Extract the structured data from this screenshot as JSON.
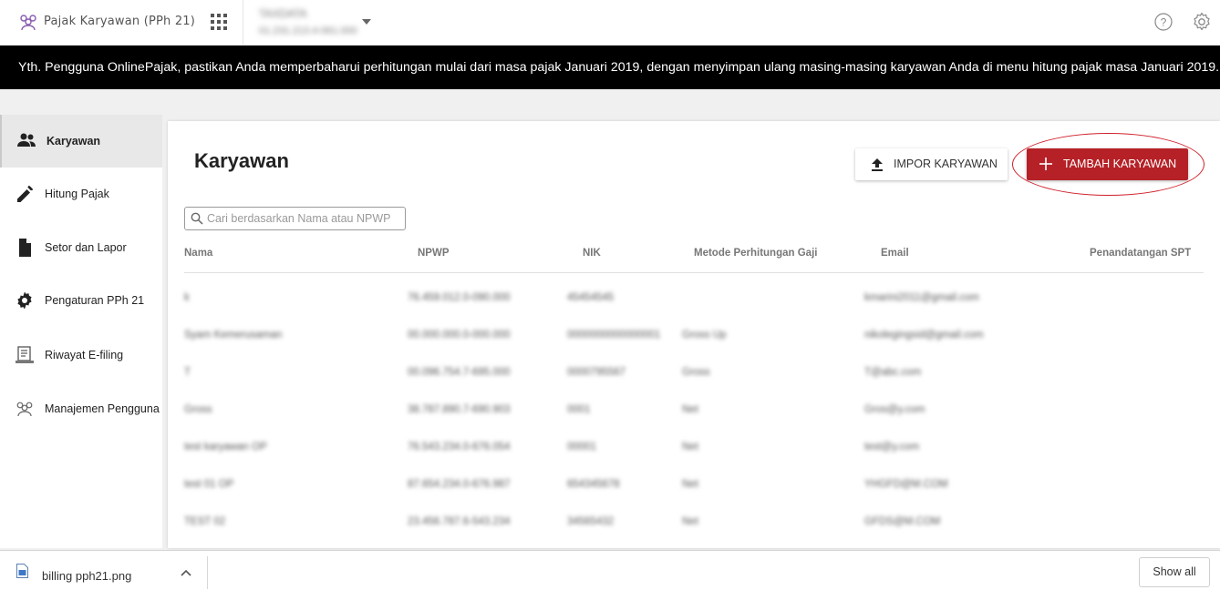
{
  "topbar": {
    "app_name": "Pajak Karyawan (PPh 21)",
    "company_name": "TAXDATA",
    "company_npwp": "01.231.213.4-061.000"
  },
  "banner": {
    "text": "Yth. Pengguna OnlinePajak, pastikan Anda memperbaharui perhitungan mulai dari masa pajak Januari 2019, dengan menyimpan ulang masing-masing karyawan Anda di menu hitung pajak masa Januari 2019."
  },
  "sidebar": {
    "items": [
      {
        "label": "Karyawan",
        "icon": "people-icon",
        "active": true
      },
      {
        "label": "Hitung Pajak",
        "icon": "pencil-icon"
      },
      {
        "label": "Setor dan Lapor",
        "icon": "document-icon"
      },
      {
        "label": "Pengaturan PPh 21",
        "icon": "gear-icon"
      },
      {
        "label": "Riwayat E-filing",
        "icon": "history-icon"
      },
      {
        "label": "Manajemen Pengguna",
        "icon": "users-icon"
      }
    ]
  },
  "main": {
    "title": "Karyawan",
    "import_label": "IMPOR KARYAWAN",
    "add_label": "TAMBAH KARYAWAN",
    "search_placeholder": "Cari berdasarkan Nama atau NPWP",
    "columns": [
      "Nama",
      "NPWP",
      "NIK",
      "Metode Perhitungan Gaji",
      "Email",
      "Penandatangan SPT"
    ],
    "rows": [
      [
        "k",
        "76.459.012.0-090.000",
        "45454545",
        "",
        "kmarini2011@gmail.com",
        ""
      ],
      [
        "Syam Kemerusaman",
        "00.000.000.0-000.000",
        "0000000000000001",
        "Gross Up",
        "nikolegingsid@gmail.com",
        ""
      ],
      [
        "T",
        "00.096.754.7-695.000",
        "0000795567",
        "Gross",
        "T@abc.com",
        ""
      ],
      [
        "Gross",
        "38.787.890.7-690.903",
        "0001",
        "Net",
        "Gros@y.com",
        ""
      ],
      [
        "test karyawan OP",
        "76.543.234.0-676.054",
        "00001",
        "Net",
        "test@y.com",
        ""
      ],
      [
        "test 01 OP",
        "87.654.234.0-676.987",
        "654345678",
        "Net",
        "YHGFD@M.COM",
        ""
      ],
      [
        "TEST 02",
        "23.456.787.6-543.234",
        "34565432",
        "Net",
        "GFDS@M.COM",
        ""
      ]
    ]
  },
  "downloads": {
    "file_name": "billing pph21.png",
    "show_all": "Show all"
  },
  "colors": {
    "accent": "#b52127",
    "banner_bg": "#000000"
  }
}
